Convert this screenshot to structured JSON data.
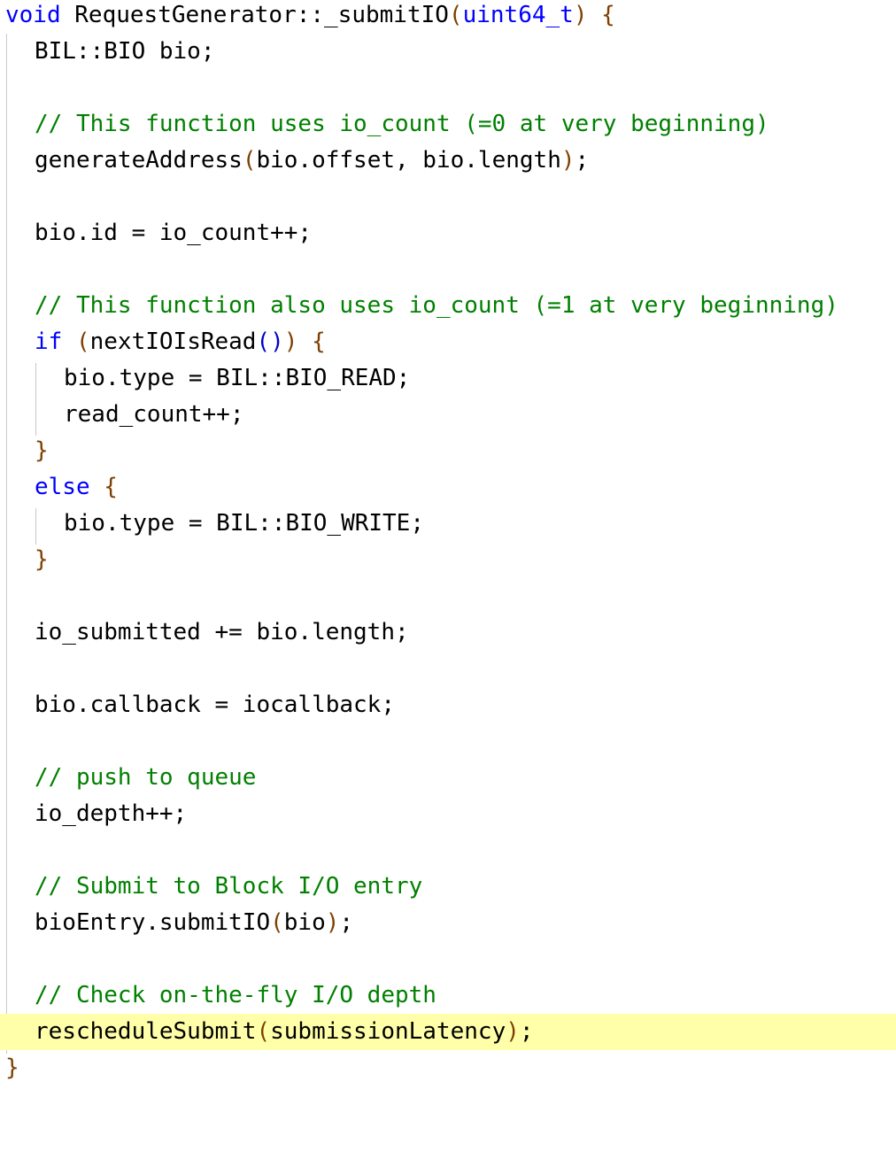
{
  "theme": {
    "keyword": "#0000ff",
    "comment": "#008000",
    "paren": "#7f3f00",
    "paren_inner": "#0000cc",
    "highlight": "#ffffaa",
    "guide": "#c8c8c8"
  },
  "code": {
    "l1": {
      "kw": "void",
      "name": " RequestGenerator::_submitIO",
      "p1": "(",
      "type": "uint64_t",
      "p2": ")",
      "brace": " {"
    },
    "l2": {
      "text": "BIL::BIO bio;"
    },
    "l4": {
      "comment": "// This function uses io_count (=0 at very beginning)"
    },
    "l5": {
      "call": "generateAddress",
      "p1": "(",
      "args": "bio.offset, bio.length",
      "p2": ")",
      "end": ";"
    },
    "l7": {
      "text": "bio.id = io_count++;"
    },
    "l9": {
      "comment": "// This function also uses io_count (=1 at very beginning)"
    },
    "l10": {
      "kw": "if",
      "sp": " ",
      "p1": "(",
      "call": "nextIOIsRead",
      "q1": "(",
      "q2": ")",
      "p2": ")",
      "brace": " {"
    },
    "l11": {
      "text": "bio.type = BIL::BIO_READ;"
    },
    "l12": {
      "text": "read_count++;"
    },
    "l13": {
      "brace": "}"
    },
    "l14": {
      "kw": "else",
      "brace": " {"
    },
    "l15": {
      "text": "bio.type = BIL::BIO_WRITE;"
    },
    "l16": {
      "brace": "}"
    },
    "l18": {
      "text": "io_submitted += bio.length;"
    },
    "l20": {
      "text": "bio.callback = iocallback;"
    },
    "l22": {
      "comment": "// push to queue"
    },
    "l23": {
      "text": "io_depth++;"
    },
    "l25": {
      "comment": "// Submit to Block I/O entry"
    },
    "l26": {
      "call": "bioEntry.submitIO",
      "p1": "(",
      "args": "bio",
      "p2": ")",
      "end": ";"
    },
    "l28": {
      "comment": "// Check on-the-fly I/O depth"
    },
    "l29": {
      "call": "rescheduleSubmit",
      "p1": "(",
      "args": "submissionLatency",
      "p2": ")",
      "end": ";"
    },
    "l30": {
      "brace": "}"
    }
  }
}
